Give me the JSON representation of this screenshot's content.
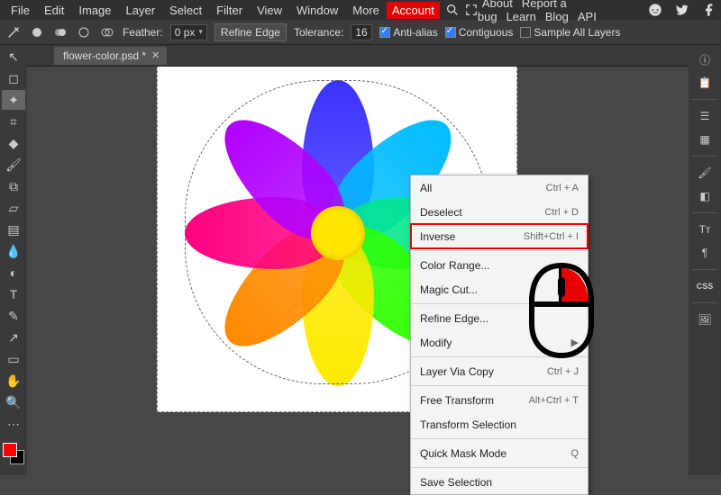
{
  "menu": {
    "items": [
      "File",
      "Edit",
      "Image",
      "Layer",
      "Select",
      "Filter",
      "View",
      "Window",
      "More"
    ],
    "account": "Account",
    "right": [
      "About",
      "Report a bug",
      "Learn",
      "Blog",
      "API"
    ]
  },
  "options": {
    "feather_label": "Feather:",
    "feather_value": "0 px",
    "refine_edge": "Refine Edge",
    "tolerance_label": "Tolerance:",
    "tolerance_value": "16",
    "antialias": "Anti-alias",
    "contiguous": "Contiguous",
    "sample_all": "Sample All Layers"
  },
  "tab": {
    "name": "flower-color.psd *"
  },
  "ctx": {
    "items": [
      {
        "label": "All",
        "shortcut": "Ctrl + A"
      },
      {
        "label": "Deselect",
        "shortcut": "Ctrl + D"
      },
      {
        "label": "Inverse",
        "shortcut": "Shift+Ctrl + I",
        "hilite": true
      },
      {
        "sep": true
      },
      {
        "label": "Color Range..."
      },
      {
        "label": "Magic Cut..."
      },
      {
        "sep": true
      },
      {
        "label": "Refine Edge..."
      },
      {
        "label": "Modify",
        "sub": true
      },
      {
        "sep": true
      },
      {
        "label": "Layer Via Copy",
        "shortcut": "Ctrl + J"
      },
      {
        "sep": true
      },
      {
        "label": "Free Transform",
        "shortcut": "Alt+Ctrl + T"
      },
      {
        "label": "Transform Selection"
      },
      {
        "sep": true
      },
      {
        "label": "Quick Mask Mode",
        "shortcut": "Q"
      },
      {
        "sep": true
      },
      {
        "label": "Save Selection"
      }
    ]
  },
  "right_panel": {
    "items": [
      "info",
      "history",
      "swatches",
      "layers",
      "brush",
      "type",
      "paragraph",
      "css",
      "image"
    ]
  },
  "flower": {
    "petals": [
      {
        "deg": 0,
        "color": "#3b32ff"
      },
      {
        "deg": 45,
        "color": "#00bcff"
      },
      {
        "deg": 90,
        "color": "#00e68a"
      },
      {
        "deg": 135,
        "color": "#2eff00"
      },
      {
        "deg": 180,
        "color": "#ffea00"
      },
      {
        "deg": 225,
        "color": "#ff8a00"
      },
      {
        "deg": 270,
        "color": "#ff0080"
      },
      {
        "deg": 315,
        "color": "#b000ff"
      }
    ]
  }
}
